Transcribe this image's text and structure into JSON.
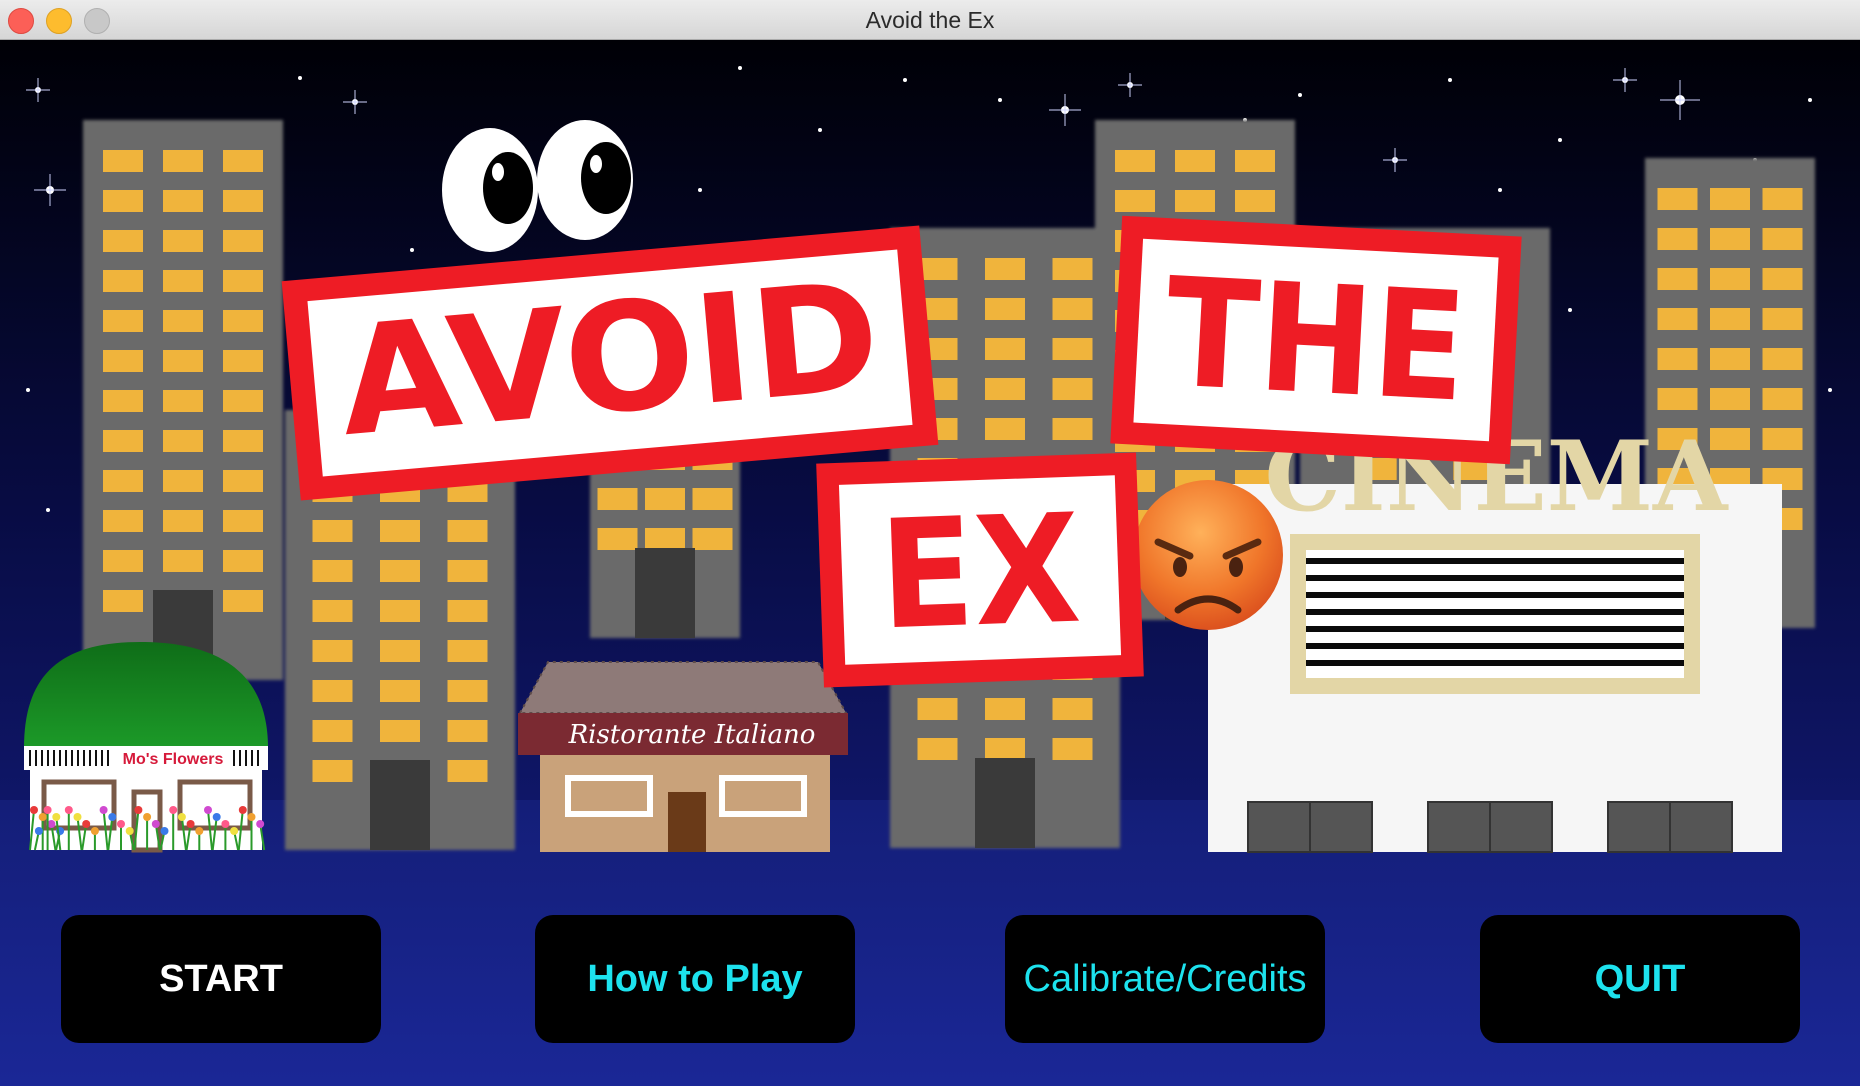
{
  "window": {
    "title": "Avoid the Ex"
  },
  "logo": {
    "word1": "AVOID",
    "word2": "THE",
    "word3": "EX",
    "color": "#ee1c25"
  },
  "shops": {
    "flowers": "Mo's Flowers",
    "restaurant": "Ristorante Italiano",
    "cinema": "CINEMA"
  },
  "menu": {
    "start": "START",
    "how_to_play": "How to Play",
    "calibrate": "Calibrate/Credits",
    "quit": "QUIT"
  },
  "colors": {
    "sky_top": "#000006",
    "sky_bottom": "#16208a",
    "window_lit": "#f0b43c",
    "button_text": "#1de2ee"
  },
  "icons": {
    "eyes": "googly-eyes",
    "emoji": "angry-face"
  }
}
